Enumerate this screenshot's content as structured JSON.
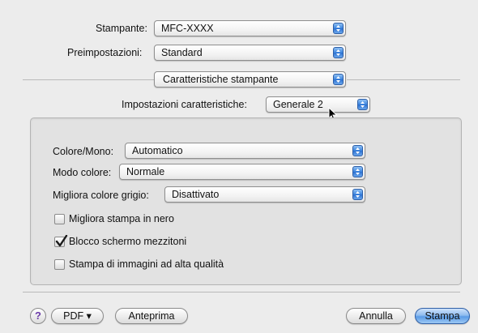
{
  "printer": {
    "label": "Stampante:",
    "value": "MFC-XXXX"
  },
  "presets": {
    "label": "Preimpostazioni:",
    "value": "Standard"
  },
  "panel_select": {
    "value": "Caratteristiche stampante"
  },
  "feature_set": {
    "label": "Impostazioni caratteristiche:",
    "value": "Generale 2"
  },
  "options": {
    "color_mono": {
      "label": "Colore/Mono:",
      "value": "Automatico"
    },
    "color_mode": {
      "label": "Modo colore:",
      "value": "Normale"
    },
    "enhance_gray": {
      "label": "Migliora colore grigio:",
      "value": "Disattivato"
    }
  },
  "checkboxes": [
    {
      "label": "Migliora stampa in nero",
      "checked": false
    },
    {
      "label": "Blocco schermo mezzitoni",
      "checked": true
    },
    {
      "label": "Stampa di immagini ad alta qualità",
      "checked": false
    }
  ],
  "footer": {
    "help": "?",
    "pdf": "PDF ▾",
    "preview": "Anteprima",
    "cancel": "Annulla",
    "print": "Stampa"
  },
  "colors": {
    "accent": "#3b84de",
    "check": "#1a1a1a"
  }
}
